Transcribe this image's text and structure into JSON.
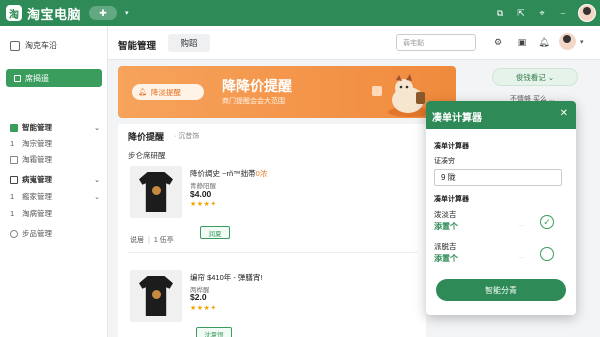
{
  "app": {
    "title": "淘宝电脑",
    "tab_pill": "✚",
    "logo": "淘"
  },
  "titlebar": {
    "icons": [
      "window-icon",
      "share-icon",
      "pin-icon",
      "minimize-icon"
    ]
  },
  "sidebar": {
    "header": "淘克车沿",
    "home": "席揭遥",
    "items": [
      {
        "label": "智能管理",
        "type": "group",
        "chevron": "⌄"
      },
      {
        "label": "淘宗管理",
        "type": "sub",
        "num": "1"
      },
      {
        "label": "淘霜管理",
        "type": "sub",
        "num": ""
      },
      {
        "label": "病嵬管理",
        "type": "group",
        "chevron": "⌄"
      },
      {
        "label": "瘢家管理",
        "type": "sub",
        "num": "1",
        "chevron": "⌄"
      },
      {
        "label": "淘病管理",
        "type": "sub",
        "num": "1"
      },
      {
        "label": "步品管理",
        "type": "sub",
        "num": ""
      }
    ]
  },
  "header": {
    "title": "智能管理",
    "tab": "购蹈",
    "search_placeholder": "蒻宅黏"
  },
  "banner": {
    "pill": "降淡提醒",
    "title": "降降价提醒",
    "subtitle": "商门提醒会会大范围"
  },
  "section": {
    "title": "降价提醒",
    "subtitle": "·  沉昔饰",
    "subsection": "步仑席研醒"
  },
  "products": [
    {
      "name": "降价绸史 ",
      "name_extra": "~rñ™拙帯",
      "name_hl": "0浓",
      "shop": "青静阳醒",
      "price": "$4.00",
      "stars": "★★★✦",
      "button": "润夏",
      "desc_a": "说居",
      "desc_b": "1 伍亭"
    },
    {
      "name": "编帘 $410年 - 弹膳宵!",
      "name_extra": "",
      "name_hl": "",
      "shop": "两桦醒",
      "price": "$2.0",
      "stars": "★★★✦",
      "button": "沈夏恨"
    }
  ],
  "right_panel": {
    "button": "俊钱看记 ⌄",
    "text": "不情够 买么 ..."
  },
  "calculator": {
    "title": "凑单计算器",
    "label_a": "凑单计算器",
    "label_b": "证凑穷",
    "input_value": "9 陇",
    "label_c": "凑单计算器",
    "row1_title": "泼淡吉",
    "row1_link": "添置个",
    "row1_hint": "····",
    "row2_title": "派脱吉",
    "row2_link": "添置个",
    "row2_hint": "····",
    "button": "智能分青"
  }
}
